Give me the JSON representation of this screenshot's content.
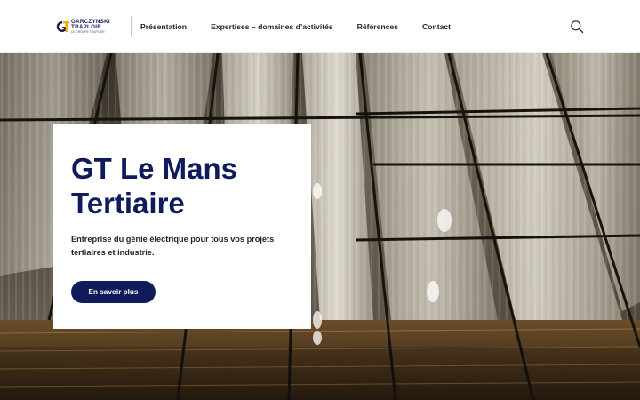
{
  "header": {
    "logo": {
      "name_line1": "GARCZYNSKI",
      "name_line2": "TRAPLOIR",
      "tagline": "LE GROUPE TRAPLOIR",
      "brand_color": "#0f1b5a",
      "accent_color": "#f2a900"
    },
    "nav": [
      {
        "label": "Présentation"
      },
      {
        "label": "Expertises – domaines d’activités"
      },
      {
        "label": "Références"
      },
      {
        "label": "Contact"
      }
    ],
    "search_icon": "search-icon"
  },
  "hero": {
    "title": "GT Le Mans Tertiaire",
    "description": "Entreprise du génie électrique pour tous vos projets tertiaires et industrie.",
    "cta_label": "En savoir plus",
    "cta_color": "#0f1b5a"
  }
}
